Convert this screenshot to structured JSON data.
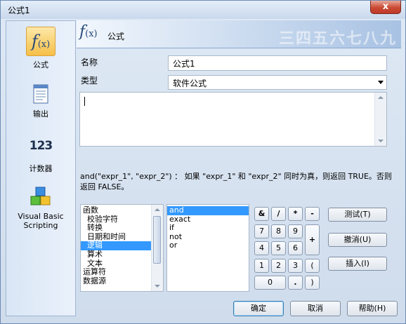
{
  "window": {
    "title": "公式1",
    "close_glyph": "x"
  },
  "sidebar": {
    "items": [
      {
        "label": "公式",
        "icon": "fx-icon",
        "selected": true
      },
      {
        "label": "输出",
        "icon": "document-icon",
        "selected": false
      },
      {
        "label": "计数器",
        "icon": "counter-icon",
        "icon_text": "123",
        "selected": false
      },
      {
        "label": "Visual Basic Scripting",
        "icon": "vb-blocks-icon",
        "selected": false
      }
    ]
  },
  "header": {
    "fx_text": "f",
    "fx_sub": "(x)",
    "title": "公式",
    "deco_text": "三四五六七八九"
  },
  "form": {
    "name_label": "名称",
    "name_value": "公式1",
    "type_label": "类型",
    "type_value": "软件公式",
    "expression_value": ""
  },
  "description": "and(\"expr_1\", \"expr_2\") ： 如果 \"expr_1\" 和 \"expr_2\" 同时为真，则返回 TRUE。否则返回 FALSE。",
  "categories": [
    {
      "label": "函数",
      "indent": false
    },
    {
      "label": "校验字符",
      "indent": true
    },
    {
      "label": "转换",
      "indent": true
    },
    {
      "label": "日期和时间",
      "indent": true
    },
    {
      "label": "逻辑",
      "indent": true,
      "selected": true
    },
    {
      "label": "算术",
      "indent": true
    },
    {
      "label": "文本",
      "indent": true
    },
    {
      "label": "运算符",
      "indent": false
    },
    {
      "label": "数据源",
      "indent": false
    }
  ],
  "functions": [
    {
      "label": "and",
      "selected": true
    },
    {
      "label": "exact"
    },
    {
      "label": "if"
    },
    {
      "label": "not"
    },
    {
      "label": "or"
    }
  ],
  "keypad": {
    "row1": [
      "&",
      "/",
      "*",
      "-"
    ],
    "row2": [
      "7",
      "8",
      "9"
    ],
    "row3": [
      "4",
      "5",
      "6"
    ],
    "plus": "+",
    "row4": [
      "1",
      "2",
      "3",
      "("
    ],
    "row5": [
      "0",
      ".",
      ")"
    ]
  },
  "actions": {
    "test": "测试(T)",
    "undo": "撤消(U)",
    "insert": "插入(I)"
  },
  "footer": {
    "ok": "确定",
    "cancel": "取消",
    "help": "帮助(H)"
  }
}
